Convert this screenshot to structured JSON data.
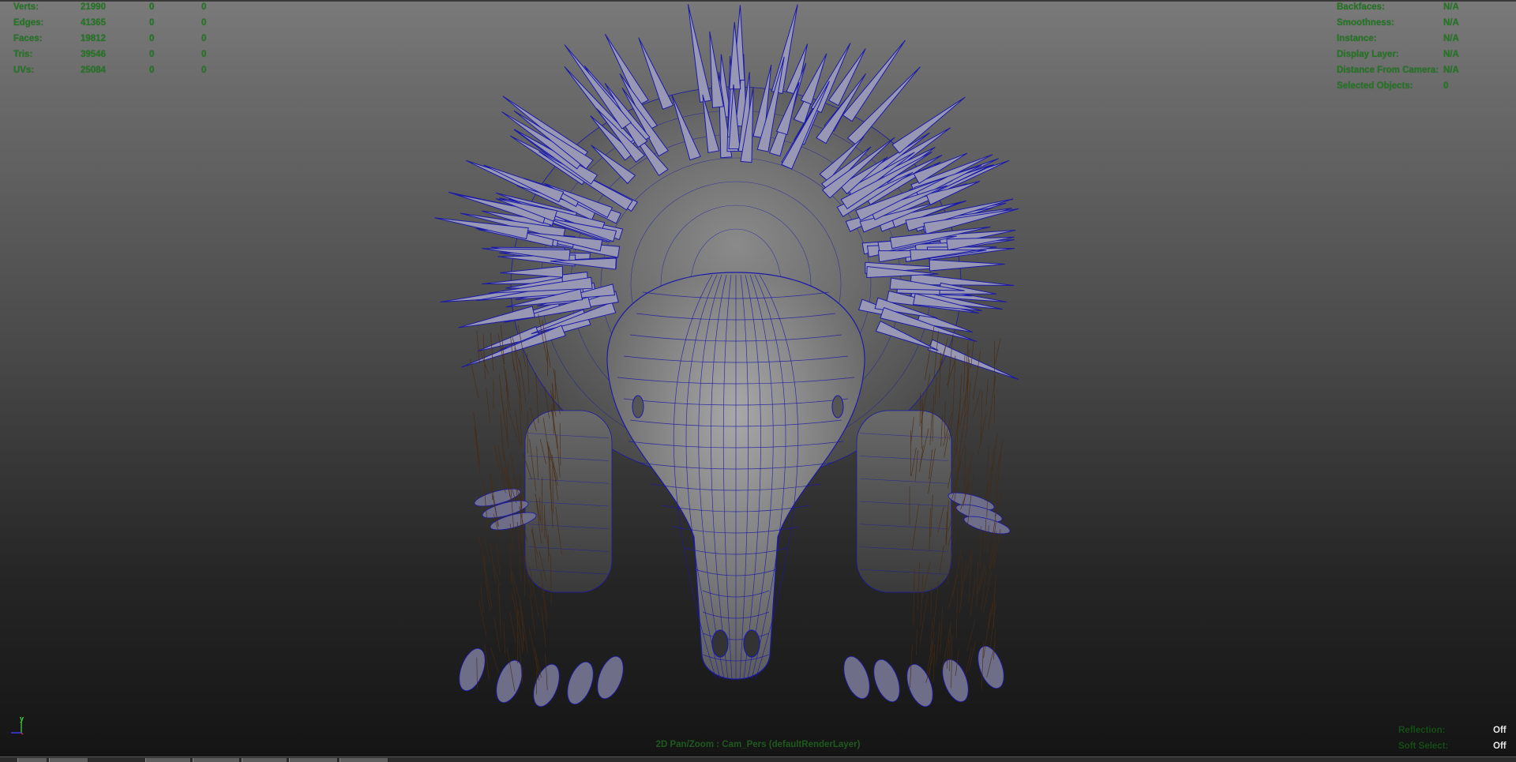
{
  "poly_count": {
    "rows": [
      {
        "label": "Verts:",
        "v1": "21990",
        "v2": "0",
        "v3": "0"
      },
      {
        "label": "Edges:",
        "v1": "41365",
        "v2": "0",
        "v3": "0"
      },
      {
        "label": "Faces:",
        "v1": "19812",
        "v2": "0",
        "v3": "0"
      },
      {
        "label": "Tris:",
        "v1": "39546",
        "v2": "0",
        "v3": "0"
      },
      {
        "label": "UVs:",
        "v1": "25084",
        "v2": "0",
        "v3": "0"
      }
    ]
  },
  "object_info": {
    "rows": [
      {
        "label": "Backfaces:",
        "value": "N/A"
      },
      {
        "label": "Smoothness:",
        "value": "N/A"
      },
      {
        "label": "Instance:",
        "value": "N/A"
      },
      {
        "label": "Display Layer:",
        "value": "N/A"
      },
      {
        "label": "Distance From Camera:",
        "value": "N/A"
      },
      {
        "label": "Selected Objects:",
        "value": "0"
      }
    ]
  },
  "viewport_settings": {
    "rows": [
      {
        "label": "Reflection:",
        "value": "Off"
      },
      {
        "label": "Soft Select:",
        "value": "Off"
      }
    ]
  },
  "camera": {
    "label": "2D Pan/Zoom : Cam_Pers (defaultRenderLayer)"
  },
  "axis": {
    "y_label": "y"
  },
  "colors": {
    "hud_text": "#1f7a1f",
    "wireframe": "#1a1aa8",
    "background_top": "#7a7a7a",
    "background_bottom": "#141414"
  },
  "icons": [
    "axis-gizmo-icon"
  ]
}
